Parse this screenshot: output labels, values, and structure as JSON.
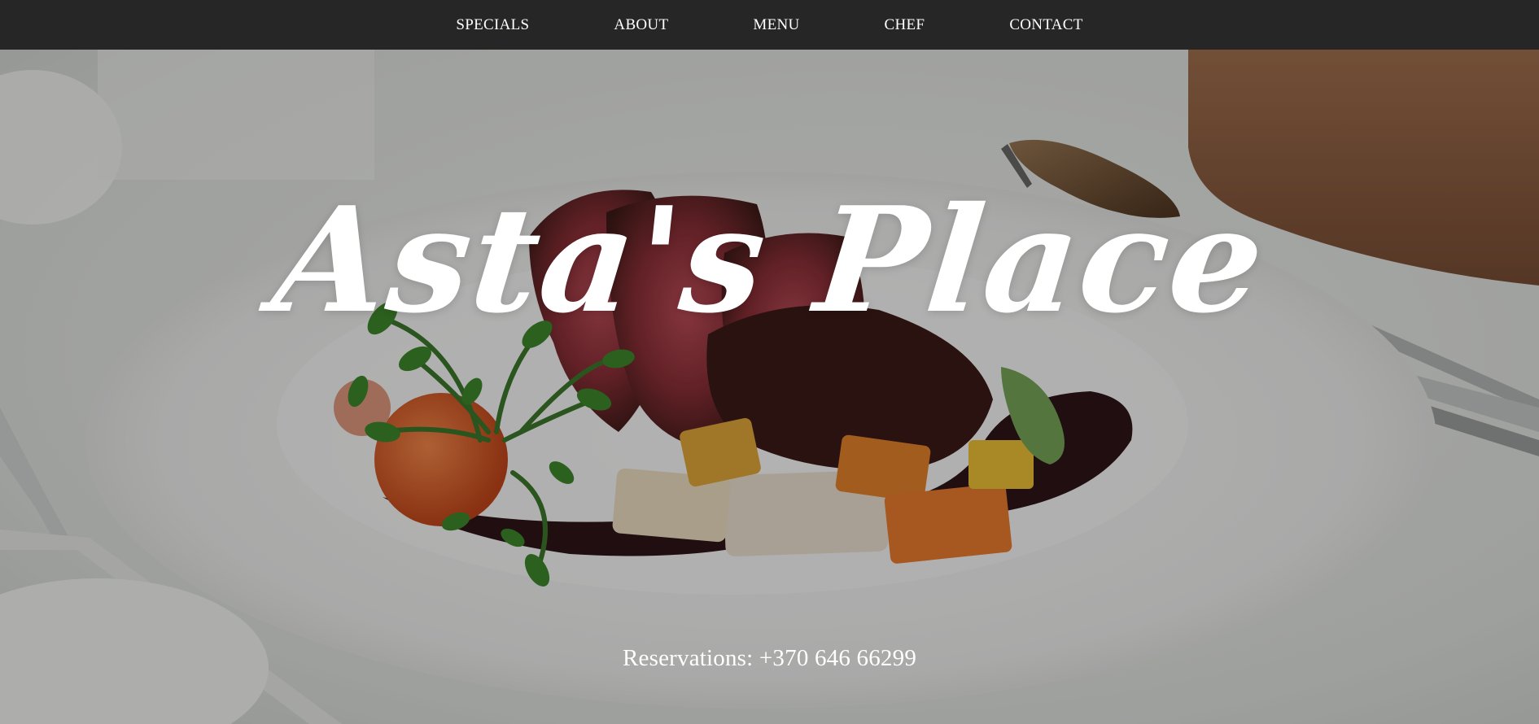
{
  "nav": {
    "items": [
      {
        "label": "SPECIALS"
      },
      {
        "label": "ABOUT"
      },
      {
        "label": "MENU"
      },
      {
        "label": "CHEF"
      },
      {
        "label": "CONTACT"
      }
    ]
  },
  "hero": {
    "title": "Asta's Place",
    "reservations": "Reservations: +370 646 66299",
    "background_image": "plated-steak-with-vegetables-photo"
  },
  "colors": {
    "nav_background": "#262626",
    "nav_text": "#ffffff",
    "hero_text": "#ffffff"
  }
}
